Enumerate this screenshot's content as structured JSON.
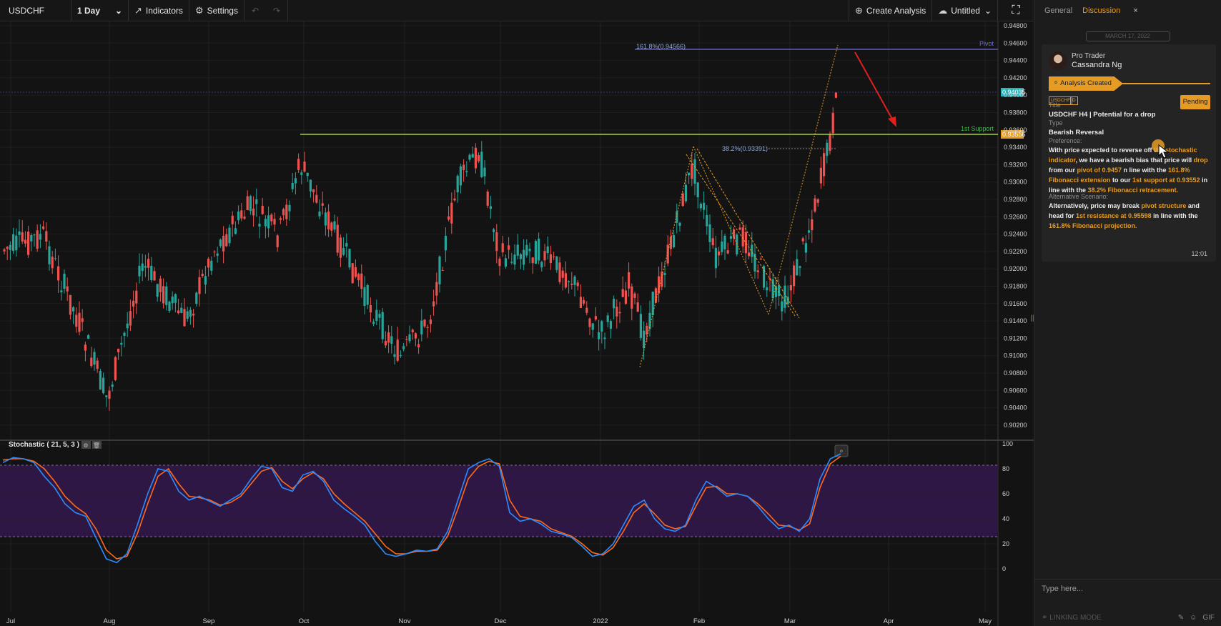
{
  "toolbar": {
    "symbol": "USDCHF",
    "interval": "1 Day",
    "indicators_label": "Indicators",
    "settings_label": "Settings",
    "create_analysis_label": "Create Analysis",
    "layout_name": "Untitled"
  },
  "chart": {
    "y_ticks": [
      "0.94800",
      "0.94600",
      "0.94400",
      "0.94200",
      "0.94000",
      "0.93800",
      "0.93600",
      "0.93400",
      "0.93200",
      "0.93000",
      "0.92800",
      "0.92600",
      "0.92400",
      "0.92200",
      "0.92000",
      "0.91800",
      "0.91600",
      "0.91400",
      "0.91200",
      "0.91000",
      "0.90800",
      "0.90600",
      "0.90400",
      "0.90200"
    ],
    "x_ticks": [
      "Jul",
      "Aug",
      "Sep",
      "Oct",
      "Nov",
      "Dec",
      "2022",
      "Feb",
      "Mar",
      "Apr",
      "May"
    ],
    "price_labels": {
      "current": "0.94035",
      "support": "0.93556"
    },
    "annotations": {
      "pivot_label": "Pivot",
      "fib_ext_label": "161.8%(0.94566)",
      "support_label": "1st Support",
      "fib_ret_label": "38.2%(0.93391)"
    },
    "colors": {
      "up": "#26a69a",
      "down": "#ef5350",
      "support": "#a6d13a",
      "pivot": "#6b6bd6",
      "fib": "#e69c24",
      "arrow": "#e01f1f"
    }
  },
  "stochastic": {
    "title": "Stochastic ( 21, 5, 3 )",
    "y_ticks": [
      "100",
      "80",
      "60",
      "40",
      "20",
      "0"
    ],
    "k_values": [
      85,
      89,
      88,
      85,
      74,
      65,
      52,
      45,
      42,
      25,
      8,
      5,
      12,
      35,
      60,
      80,
      78,
      62,
      55,
      58,
      54,
      50,
      55,
      60,
      72,
      82,
      80,
      65,
      62,
      75,
      78,
      70,
      55,
      48,
      42,
      35,
      22,
      12,
      10,
      12,
      15,
      14,
      16,
      30,
      55,
      80,
      85,
      88,
      82,
      45,
      38,
      40,
      36,
      30,
      28,
      25,
      18,
      10,
      12,
      20,
      35,
      50,
      55,
      40,
      32,
      30,
      35,
      55,
      70,
      65,
      58,
      60,
      58,
      50,
      40,
      32,
      35,
      30,
      40,
      72,
      88,
      92
    ],
    "d_values": [
      87,
      88,
      88,
      86,
      80,
      70,
      58,
      50,
      44,
      32,
      15,
      8,
      10,
      28,
      52,
      74,
      80,
      68,
      58,
      57,
      55,
      51,
      53,
      58,
      68,
      78,
      81,
      70,
      64,
      72,
      77,
      72,
      60,
      52,
      45,
      38,
      28,
      18,
      12,
      12,
      14,
      14,
      15,
      26,
      48,
      72,
      82,
      86,
      84,
      55,
      42,
      40,
      38,
      32,
      29,
      26,
      20,
      13,
      11,
      17,
      30,
      45,
      52,
      44,
      35,
      32,
      34,
      50,
      65,
      66,
      60,
      60,
      58,
      52,
      44,
      35,
      34,
      31,
      36,
      65,
      84,
      90
    ],
    "colors": {
      "k": "#2b8cff",
      "d": "#ff6a1a",
      "band": "#2e1745"
    }
  },
  "panel": {
    "tabs": [
      {
        "label": "General"
      },
      {
        "label": "Discussion"
      }
    ],
    "close_label": "×",
    "date": "MARCH 17, 2022",
    "role": "Pro Trader",
    "author": "Cassandra Ng",
    "status": "Analysis Created",
    "tags": [
      "USDCHF",
      "D"
    ],
    "pending": "Pending",
    "title_label": "Title",
    "title_value": "USDCHF H4 | Potential for a drop",
    "type_label": "Type",
    "type_value": "Bearish Reversal",
    "pref_label": "Preference:",
    "pref_parts": [
      [
        "With price expected to reverse off the ",
        false
      ],
      [
        "stochastic indicator",
        true
      ],
      [
        ", we have a bearish bias that price will ",
        false
      ],
      [
        "drop",
        true
      ],
      [
        " from our ",
        false
      ],
      [
        "pivot of 0.9457",
        true
      ],
      [
        " n line with the ",
        false
      ],
      [
        "161.8% Fibonacci extension",
        true
      ],
      [
        " to our ",
        false
      ],
      [
        "1st support at 0.93552",
        true
      ],
      [
        " in line with the ",
        false
      ],
      [
        "38.2% Fibonacci retracement.",
        true
      ]
    ],
    "alt_label": "Alternative Scenario:",
    "alt_parts": [
      [
        "Alternatively, price may break ",
        false
      ],
      [
        "pivot structure",
        true
      ],
      [
        " and head for ",
        false
      ],
      [
        "1st resistance at 0.95598",
        true
      ],
      [
        " in line with the ",
        false
      ],
      [
        "161.8% Fibonacci projection.",
        true
      ]
    ],
    "time": "12:01",
    "compose_placeholder": "Type here...",
    "linking_mode": "LINKING MODE",
    "gif_label": "GIF"
  }
}
